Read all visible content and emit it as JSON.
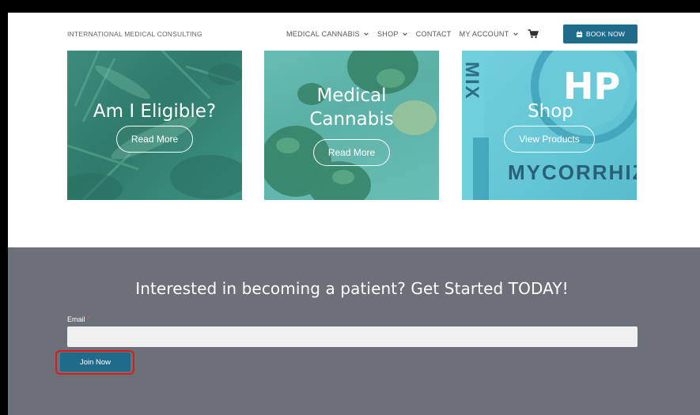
{
  "header": {
    "brand": "INTERNATIONAL MEDICAL CONSULTING",
    "nav": [
      {
        "label": "MEDICAL CANNABIS",
        "has_dropdown": true
      },
      {
        "label": "SHOP",
        "has_dropdown": true
      },
      {
        "label": "CONTACT",
        "has_dropdown": false
      },
      {
        "label": "MY ACCOUNT",
        "has_dropdown": true
      }
    ],
    "cart_icon": "cart-icon",
    "book_now": "BOOK NOW"
  },
  "cards": [
    {
      "title": "Am I Eligible?",
      "button": "Read More"
    },
    {
      "title_line1": "Medical",
      "title_line2": "Cannabis",
      "button": "Read More"
    },
    {
      "title": "Shop",
      "button": "View Products",
      "product_text_large": "HP",
      "product_text_side": "MIX",
      "product_text_bottom": "MYCORRHIZ"
    }
  ],
  "signup": {
    "heading": "Interested in becoming a patient? Get Started TODAY!",
    "email_label": "Email",
    "required_mark": "*",
    "email_value": "",
    "submit": "Join Now"
  },
  "colors": {
    "accent": "#1e6b8c",
    "signup_bg": "#6b7079",
    "highlight": "#e01818"
  }
}
